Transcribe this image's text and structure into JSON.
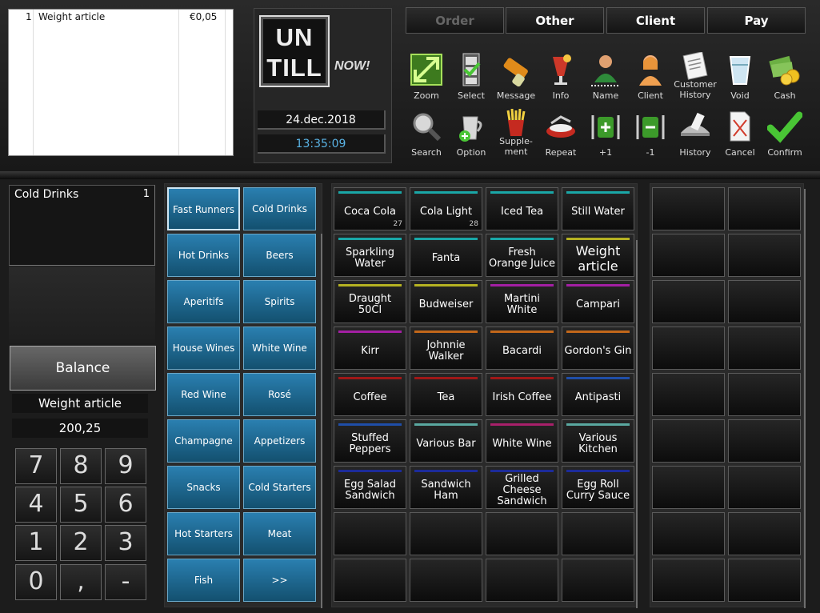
{
  "receipt": {
    "rows": [
      {
        "qty": "1",
        "name": "Weight article",
        "price": "€0,05"
      }
    ]
  },
  "logo": {
    "line1": "UN",
    "line2": "TILL",
    "now": "NOW!"
  },
  "date": "24.dec.2018",
  "time": "13:35:09",
  "tabs": [
    {
      "label": "Order",
      "disabled": true
    },
    {
      "label": "Other"
    },
    {
      "label": "Client"
    },
    {
      "label": "Pay"
    }
  ],
  "toolbar_row1": [
    {
      "icon": "zoom-icon",
      "label": "Zoom"
    },
    {
      "icon": "select-icon",
      "label": "Select"
    },
    {
      "icon": "message-icon",
      "label": "Message"
    },
    {
      "icon": "info-icon",
      "label": "Info"
    },
    {
      "icon": "name-icon",
      "label": "Name"
    },
    {
      "icon": "client-icon",
      "label": "Client"
    },
    {
      "icon": "customer-history-icon",
      "label": "Customer History"
    },
    {
      "icon": "void-icon",
      "label": "Void"
    },
    {
      "icon": "cash-icon",
      "label": "Cash"
    }
  ],
  "toolbar_row2": [
    {
      "icon": "search-icon",
      "label": "Search"
    },
    {
      "icon": "option-icon",
      "label": "Option"
    },
    {
      "icon": "supplement-icon",
      "label": "Supple-ment"
    },
    {
      "icon": "repeat-icon",
      "label": "Repeat"
    },
    {
      "icon": "plus-one-icon",
      "label": "+1"
    },
    {
      "icon": "minus-one-icon",
      "label": "-1"
    },
    {
      "icon": "history-icon",
      "label": "History"
    },
    {
      "icon": "cancel-icon",
      "label": "Cancel"
    },
    {
      "icon": "confirm-icon",
      "label": "Confirm"
    }
  ],
  "order": {
    "name": "Cold Drinks",
    "count": "1"
  },
  "balance_label": "Balance",
  "info": {
    "article": "Weight article",
    "amount": "200,25"
  },
  "numpad": [
    "7",
    "8",
    "9",
    "4",
    "5",
    "6",
    "1",
    "2",
    "3",
    "0",
    ",",
    "-"
  ],
  "categories": [
    "Fast Runners",
    "Cold Drinks",
    "Hot Drinks",
    "Beers",
    "Aperitifs",
    "Spirits",
    "House Wines",
    "White Wine",
    "Red Wine",
    "Rosé",
    "Champagne",
    "Appetizers",
    "Snacks",
    "Cold Starters",
    "Hot Starters",
    "Meat",
    "Fish",
    ">>"
  ],
  "selected_category": "Fast Runners",
  "colors": {
    "teal": "#1aa7a7",
    "yellow": "#b5b222",
    "magenta": "#a31fa3",
    "orange": "#c2671a",
    "red": "#a01818",
    "blue": "#1f4ea8",
    "mint": "#5aa8a0",
    "pink": "#a8206a",
    "navy": "#1c2b9a",
    "category_blue": "#1c6790"
  },
  "articles": [
    {
      "name": "Coca Cola",
      "qty": "27",
      "color": "#1aa7a7"
    },
    {
      "name": "Cola Light",
      "qty": "28",
      "color": "#1aa7a7"
    },
    {
      "name": "Iced Tea",
      "color": "#1aa7a7"
    },
    {
      "name": "Still Water",
      "color": "#1aa7a7"
    },
    {
      "name": "Sparkling Water",
      "color": "#1aa7a7"
    },
    {
      "name": "Fanta",
      "color": "#1aa7a7"
    },
    {
      "name": "Fresh Orange Juice",
      "color": "#1aa7a7"
    },
    {
      "name": "Weight article",
      "color": "#b5b222",
      "big": true
    },
    {
      "name": "Draught 50Cl",
      "color": "#b5b222"
    },
    {
      "name": "Budweiser",
      "color": "#b5b222"
    },
    {
      "name": "Martini White",
      "color": "#a31fa3"
    },
    {
      "name": "Campari",
      "color": "#a31fa3"
    },
    {
      "name": "Kirr",
      "color": "#a31fa3"
    },
    {
      "name": "Johnnie Walker",
      "color": "#c2671a"
    },
    {
      "name": "Bacardi",
      "color": "#c2671a"
    },
    {
      "name": "Gordon's Gin",
      "color": "#c2671a"
    },
    {
      "name": "Coffee",
      "color": "#a01818"
    },
    {
      "name": "Tea",
      "color": "#a01818"
    },
    {
      "name": "Irish Coffee",
      "color": "#a01818"
    },
    {
      "name": "Antipasti",
      "color": "#1f4ea8"
    },
    {
      "name": "Stuffed Peppers",
      "color": "#1f4ea8"
    },
    {
      "name": "Various Bar",
      "color": "#5aa8a0"
    },
    {
      "name": "White Wine",
      "color": "#a8206a"
    },
    {
      "name": "Various Kitchen",
      "color": "#5aa8a0"
    },
    {
      "name": "Egg Salad Sandwich",
      "color": "#1c2b9a"
    },
    {
      "name": "Sandwich Ham",
      "color": "#1c2b9a"
    },
    {
      "name": "Grilled Cheese Sandwich",
      "color": "#1c2b9a"
    },
    {
      "name": "Egg Roll Curry Sauce",
      "color": "#1c2b9a"
    }
  ]
}
